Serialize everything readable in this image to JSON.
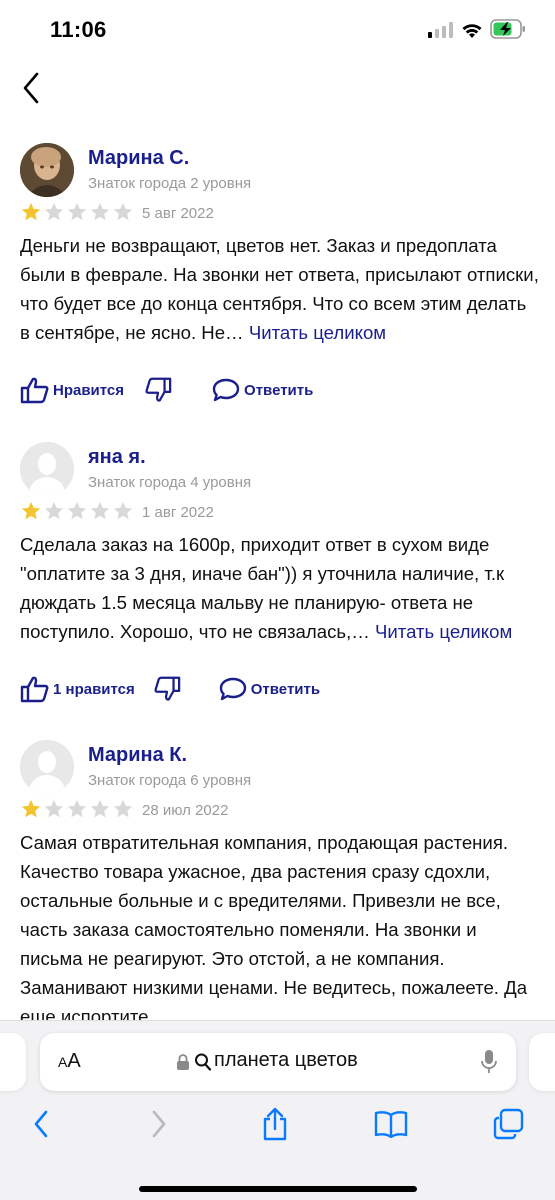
{
  "status_bar": {
    "time": "11:06"
  },
  "colors": {
    "accent": "#1a1f8c",
    "star_filled": "#f4c430",
    "star_empty": "#d8d8d8",
    "muted": "#9a9a9a",
    "ios_blue": "#0a7aff"
  },
  "reviews": [
    {
      "author": "Марина С.",
      "level": "Знаток города 2 уровня",
      "rating": 1,
      "date": "5 авг 2022",
      "text": "Деньги не возвращают, цветов нет. Заказ и предоплата были в феврале. На звонки нет ответа, присылают отписки, что будет все до конца сентября. Что со всем этим делать в сентябре, не ясно. Не…",
      "read_more": "Читать целиком",
      "like_label": "Нравится",
      "reply_label": "Ответить"
    },
    {
      "author": "яна я.",
      "level": "Знаток города 4 уровня",
      "rating": 1,
      "date": "1 авг 2022",
      "text": "Сделала заказ на 1600р, приходит ответ в сухом виде \"оплатите за 3 дня, иначе бан\")) я уточнила наличие, т.к дюждать 1.5 месяца мальву не планирую- ответа не поступило. Хорошо, что не связалась,…",
      "read_more": "Читать целиком",
      "like_label": "1 нравится",
      "reply_label": "Ответить"
    },
    {
      "author": "Марина К.",
      "level": "Знаток города 6 уровня",
      "rating": 1,
      "date": "28 июл 2022",
      "text": "Самая отвратительная компания, продающая растения. Качество товара ужасное, два растения сразу сдохли, остальные больные и с вредителями. Привезли не все, часть заказа самостоятельно поменяли. На звонки и письма не реагируют. Это отстой, а не компания. Заманивают низкими ценами. Не ведитесь, пожалеете. Да еще испортите",
      "read_more": "",
      "like_label": "",
      "reply_label": ""
    }
  ],
  "browser": {
    "aa_label_small": "A",
    "aa_label_large": "A",
    "address": "планета цветов"
  }
}
